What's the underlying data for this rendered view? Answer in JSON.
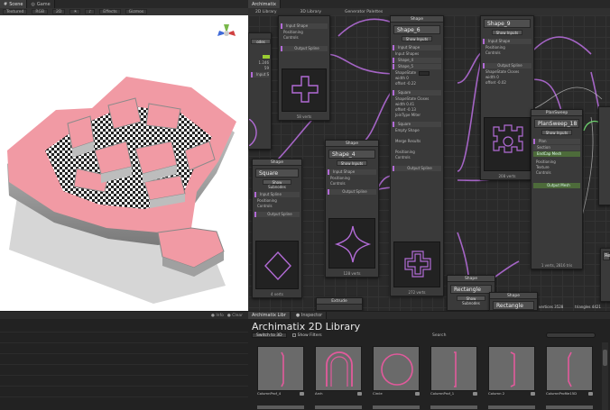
{
  "scene": {
    "tabs": [
      {
        "label": "Scene",
        "active": true
      },
      {
        "label": "Game",
        "active": false
      }
    ],
    "toolbar": [
      "Textured",
      "RGB",
      "2D",
      "☀",
      "♪",
      "Effects",
      "Gizmos"
    ]
  },
  "lower_left": {
    "right_controls": [
      "● Info",
      "● Clear"
    ]
  },
  "graph": {
    "tab": "Archimatix",
    "menu": [
      "2D Library",
      "3D Library",
      "Generator Palettes"
    ],
    "nodes": {
      "left_partial": {
        "button": "odes",
        "field_a": "1.246",
        "field_b": "59",
        "port": "Input Spline"
      },
      "mid_top": {
        "port_in": "Input Shape",
        "rows": [
          "Positioning",
          "Controls"
        ],
        "port_out": "Output Spline",
        "footer": "58 verts"
      },
      "square": {
        "header": "Shape",
        "name": "Square",
        "button": "Show Subnodes",
        "port_in": "Input Spline",
        "rows": [
          "Positioning",
          "Controls"
        ],
        "port_out": "Output Spline",
        "footer": "4 verts"
      },
      "shape_4": {
        "header": "Shape",
        "name": "Shape_4",
        "button": "Show Inputs",
        "port_in": "Input Shape",
        "rows": [
          "Positioning",
          "Controls"
        ],
        "port_out": "Output Spline",
        "footer": "128 verts"
      },
      "shape_6": {
        "header": "Shape",
        "name": "Shape_6",
        "button": "Show Inputs",
        "port_in": "Input Shape",
        "section": "Input Shapes",
        "inputs": [
          "Shape_4",
          "Shape_5"
        ],
        "shapestate": "ShapeState",
        "state_value": "Closes",
        "width": "width 0",
        "offset": "offset -0.22",
        "square": "Square",
        "state_value_2": "Closes",
        "width_2": "width 0.41",
        "offset_2": "offset -0.13",
        "jointype": "JoinType",
        "jointype_value": "Miter",
        "square_2": "Square",
        "empty": "Empty Shape",
        "merge": "Merge Results",
        "rows": [
          "Positioning",
          "Controls"
        ],
        "port_out": "Output Spline",
        "footer": "272 verts"
      },
      "shape_9": {
        "header": "Shape",
        "name": "Shape_9",
        "button": "Show Inputs",
        "port_in": "Input Shape",
        "rows": [
          "Positioning",
          "Controls"
        ],
        "shapestate": "ShapeState",
        "state_value": "Closes",
        "port_out": "Output Spline",
        "width": "width 0",
        "offset": "offset -0.02",
        "footer": "208 verts"
      },
      "plansweep": {
        "header": "PlanSweep",
        "name": "PlanSweep_18",
        "button": "Show Inputs",
        "plan": "Plan",
        "section_port": "Section",
        "end": "EndCap Mesh",
        "rows": [
          "Positioning",
          "Texture",
          "Controls"
        ],
        "port_out": "Output Mesh",
        "footer": "1 verts, 2816 tris"
      },
      "rect": {
        "header": "Shape",
        "name": "Rectangle",
        "button": "Show Subnodes"
      },
      "shape_r": {
        "header": "Shape",
        "name": "Rectangle"
      },
      "extrude": {
        "header": "Extrude"
      },
      "stats": {
        "a": "vertices 3528",
        "b": "triangles 4421"
      }
    }
  },
  "library": {
    "tabs": [
      {
        "label": "Archimatix Libr",
        "active": true
      },
      {
        "label": "● Inspector",
        "active": false
      }
    ],
    "title": "Archimatix 2D Library",
    "switch_button": "Switch to 3D",
    "show_filters": "Show Filters",
    "search_label": "Search",
    "items": [
      "ColumnProf_4",
      "Arch",
      "Circle",
      "ColumnProf_1",
      "Column 2",
      "ColumnProfile15D"
    ]
  },
  "colors": {
    "pink": "#f19aa4",
    "purple": "#b26bd6",
    "panel": "#3a3a3a"
  }
}
